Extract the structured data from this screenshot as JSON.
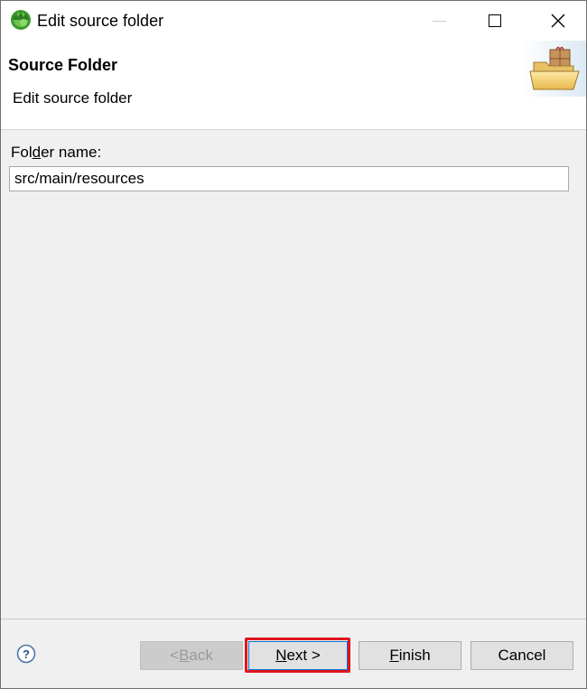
{
  "window": {
    "title": "Edit source folder",
    "icon": "eclipse-icon"
  },
  "banner": {
    "title": "Source Folder",
    "description": "Edit source folder",
    "image": "folder-package-icon"
  },
  "form": {
    "folder_label_pre": "Fol",
    "folder_label_mnemonic": "d",
    "folder_label_post": "er name:",
    "folder_value": "src/main/resources"
  },
  "buttons": {
    "back_pre": "< ",
    "back_mnemonic": "B",
    "back_post": "ack",
    "next_mnemonic": "N",
    "next_post": "ext >",
    "finish_mnemonic": "F",
    "finish_post": "inish",
    "cancel": "Cancel"
  },
  "colors": {
    "highlight": "#e0141e",
    "focus": "#0078d7"
  }
}
